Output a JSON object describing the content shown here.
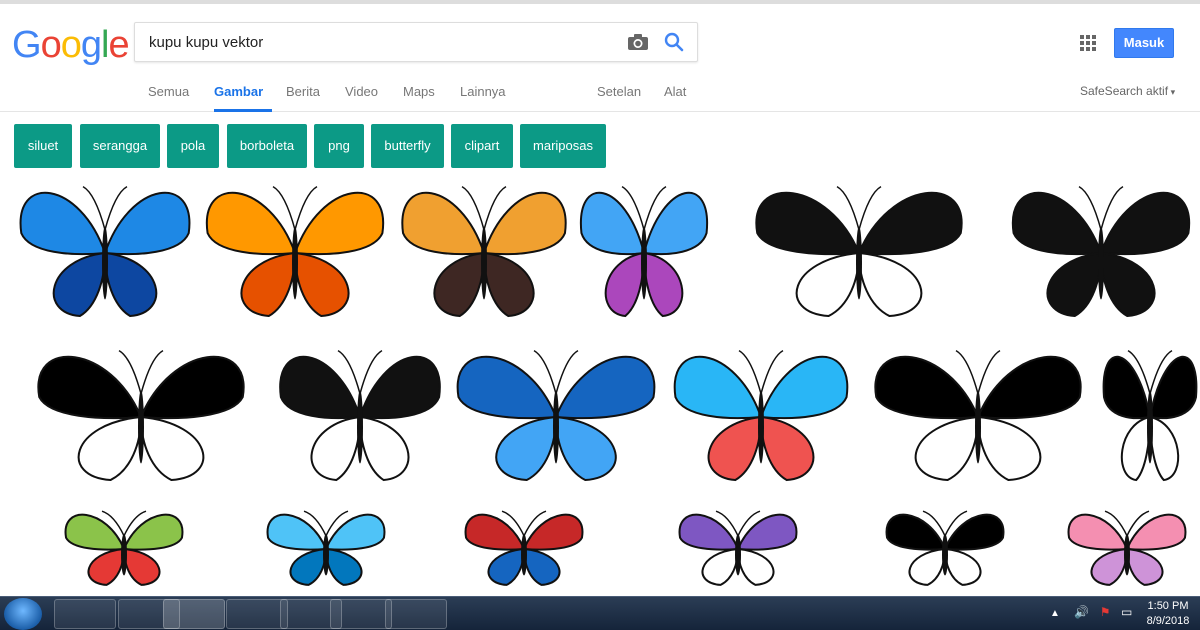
{
  "logo": {
    "letters": [
      "G",
      "o",
      "o",
      "g",
      "l",
      "e"
    ],
    "colors": [
      "#4285f4",
      "#ea4335",
      "#fbbc05",
      "#4285f4",
      "#34a853",
      "#ea4335"
    ]
  },
  "search": {
    "query": "kupu kupu vektor"
  },
  "header": {
    "signin_label": "Masuk",
    "safesearch_label": "SafeSearch aktif"
  },
  "tabs": [
    "Semua",
    "Gambar",
    "Berita",
    "Video",
    "Maps",
    "Lainnya",
    "Setelan",
    "Alat"
  ],
  "active_tab": "Gambar",
  "chips": [
    "siluet",
    "serangga",
    "pola",
    "borboleta",
    "png",
    "butterfly",
    "clipart",
    "mariposas"
  ],
  "results": [
    {
      "name": "blue-butterfly",
      "colors": [
        "#1e88e5",
        "#0d47a1"
      ]
    },
    {
      "name": "orange-butterfly",
      "colors": [
        "#ff9800",
        "#e65100"
      ]
    },
    {
      "name": "monarch-butterfly",
      "colors": [
        "#f0a030",
        "#3e2723"
      ]
    },
    {
      "name": "colorful-butterflies-set",
      "colors": [
        "#42a5f5",
        "#ab47bc"
      ]
    },
    {
      "name": "black-white-butterfly",
      "colors": [
        "#111111",
        "#ffffff"
      ]
    },
    {
      "name": "butterfly-silhouettes",
      "colors": [
        "#111111",
        "#111111"
      ]
    },
    {
      "name": "black-butterfly",
      "colors": [
        "#000000",
        "#ffffff"
      ]
    },
    {
      "name": "silhouette-vector-pack",
      "colors": [
        "#111111",
        "#ffffff"
      ]
    },
    {
      "name": "tribal-blue-butterfly",
      "colors": [
        "#1565c0",
        "#42a5f5"
      ]
    },
    {
      "name": "colorful-butterflies-grid",
      "colors": [
        "#29b6f6",
        "#ef5350"
      ]
    },
    {
      "name": "outline-butterfly",
      "colors": [
        "#000000",
        "#ffffff"
      ]
    },
    {
      "name": "small-sketch-butterfly",
      "colors": [
        "#000000",
        "#ffffff"
      ]
    },
    {
      "name": "rainbow-butterfly",
      "colors": [
        "#8bc34a",
        "#e53935"
      ]
    },
    {
      "name": "light-blue-butterfly",
      "colors": [
        "#4fc3f7",
        "#0277bd"
      ]
    },
    {
      "name": "red-blue-butterfly",
      "colors": [
        "#c62828",
        "#1565c0"
      ]
    },
    {
      "name": "purple-ornate-butterfly",
      "colors": [
        "#7e57c2",
        "#ffffff"
      ]
    },
    {
      "name": "outline-butterfly-2",
      "colors": [
        "#000000",
        "#ffffff"
      ]
    },
    {
      "name": "pink-butterfly",
      "colors": [
        "#f48fb1",
        "#ce93d8"
      ]
    }
  ],
  "taskbar": {
    "clock_time": "1:50 PM",
    "clock_date": "8/9/2018",
    "apps": [
      "file-explorer",
      "blender",
      "chrome",
      "media-player",
      "window-app",
      "paint-app",
      "sublime-app"
    ]
  }
}
